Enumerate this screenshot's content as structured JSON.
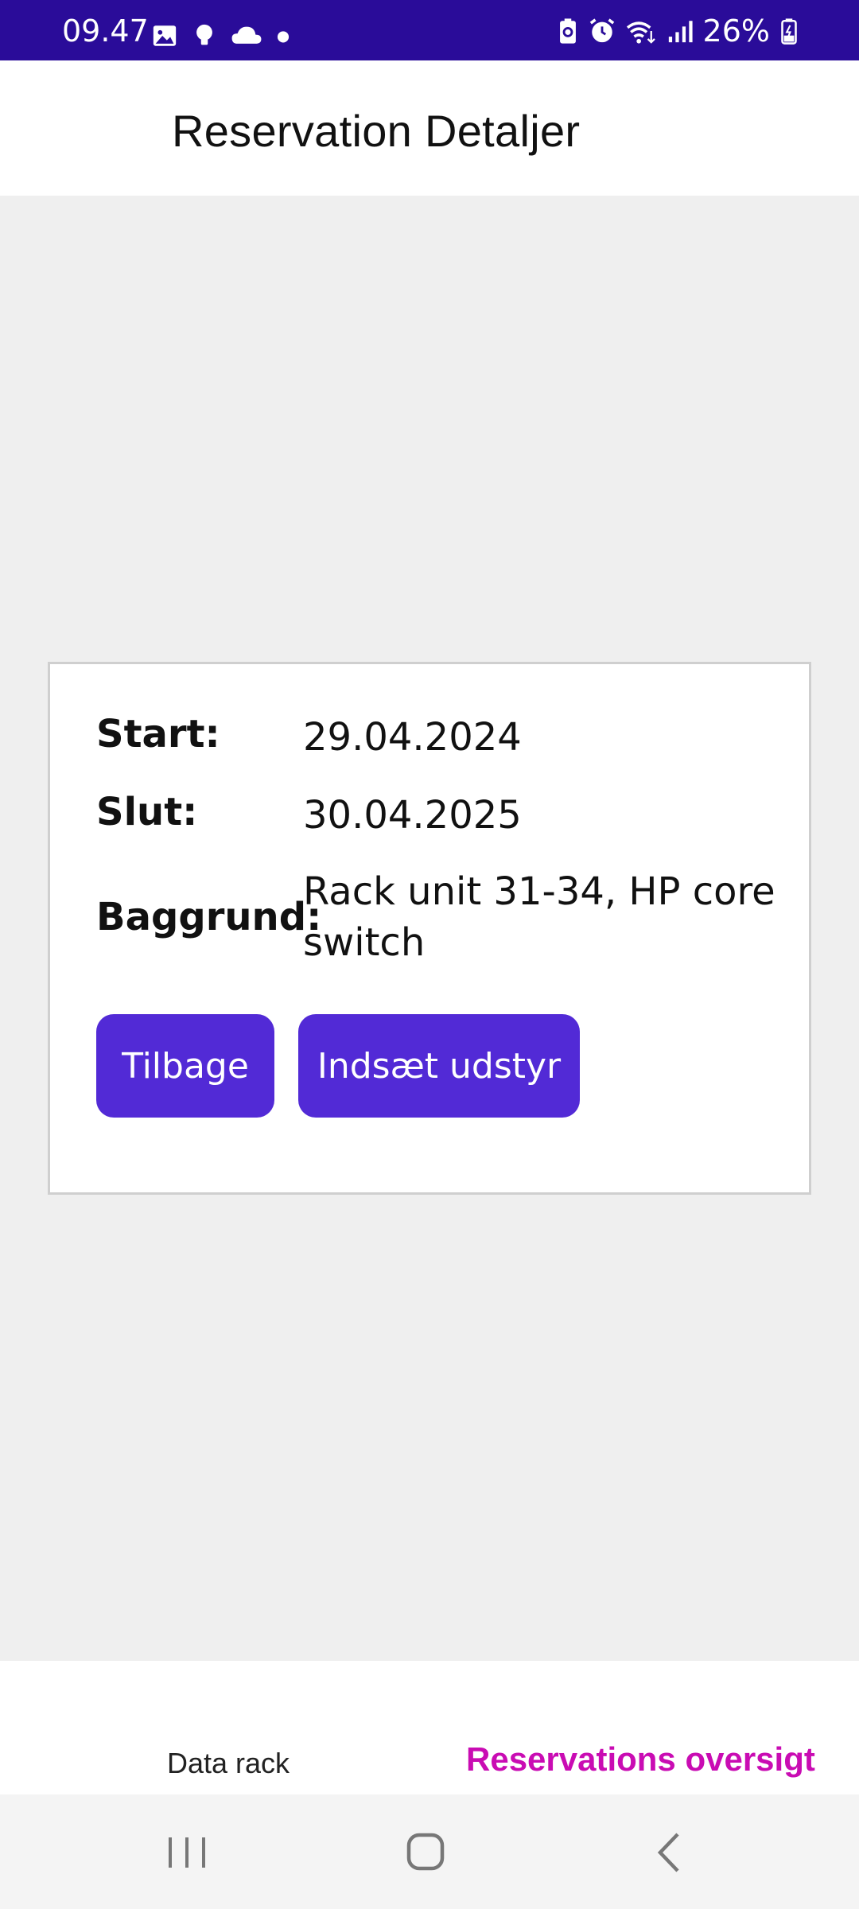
{
  "status_bar": {
    "time": "09.47",
    "battery": "26%",
    "left_icons": [
      "image-icon",
      "bulb-icon",
      "cloud-icon",
      "dot-icon"
    ],
    "right_icons": [
      "battery-saver-icon",
      "alarm-icon",
      "wifi-icon",
      "signal-icon",
      "battery-icon"
    ]
  },
  "header": {
    "title": "Reservation Detaljer"
  },
  "details": {
    "start_label": "Start:",
    "start_value": "29.04.2024",
    "slut_label": "Slut:",
    "slut_value": "30.04.2025",
    "baggrund_label": "Baggrund:",
    "baggrund_value": "Rack unit 31-34, HP core switch"
  },
  "buttons": {
    "back": "Tilbage",
    "insert": "Indsæt udstyr"
  },
  "bottom_nav": {
    "items": [
      {
        "label": "Data rack",
        "active": false
      },
      {
        "label": "Reservations oversigt",
        "active": true
      }
    ],
    "active_color": "#c90cb3"
  },
  "colors": {
    "status_bar": "#2a0c99",
    "button": "#522ad6",
    "background": "#efefef"
  }
}
